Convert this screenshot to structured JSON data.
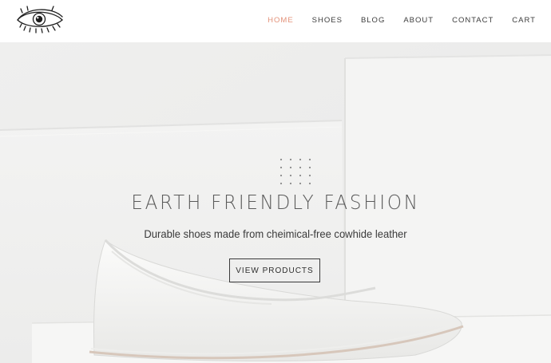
{
  "nav": {
    "items": [
      {
        "label": "HOME",
        "active": true
      },
      {
        "label": "SHOES",
        "active": false
      },
      {
        "label": "BLOG",
        "active": false
      },
      {
        "label": "ABOUT",
        "active": false
      },
      {
        "label": "CONTACT",
        "active": false
      },
      {
        "label": "CART",
        "active": false
      }
    ]
  },
  "hero": {
    "title": "EARTH FRIENDLY FASHION",
    "subtitle": "Durable shoes made from cheimical-free cowhide leather",
    "cta_label": "VIEW PRODUCTS"
  },
  "colors": {
    "accent": "#e3927a",
    "text": "#3c3c3c",
    "hero_bg": "#efefee"
  },
  "icons": {
    "logo": "eye-logo-icon"
  }
}
